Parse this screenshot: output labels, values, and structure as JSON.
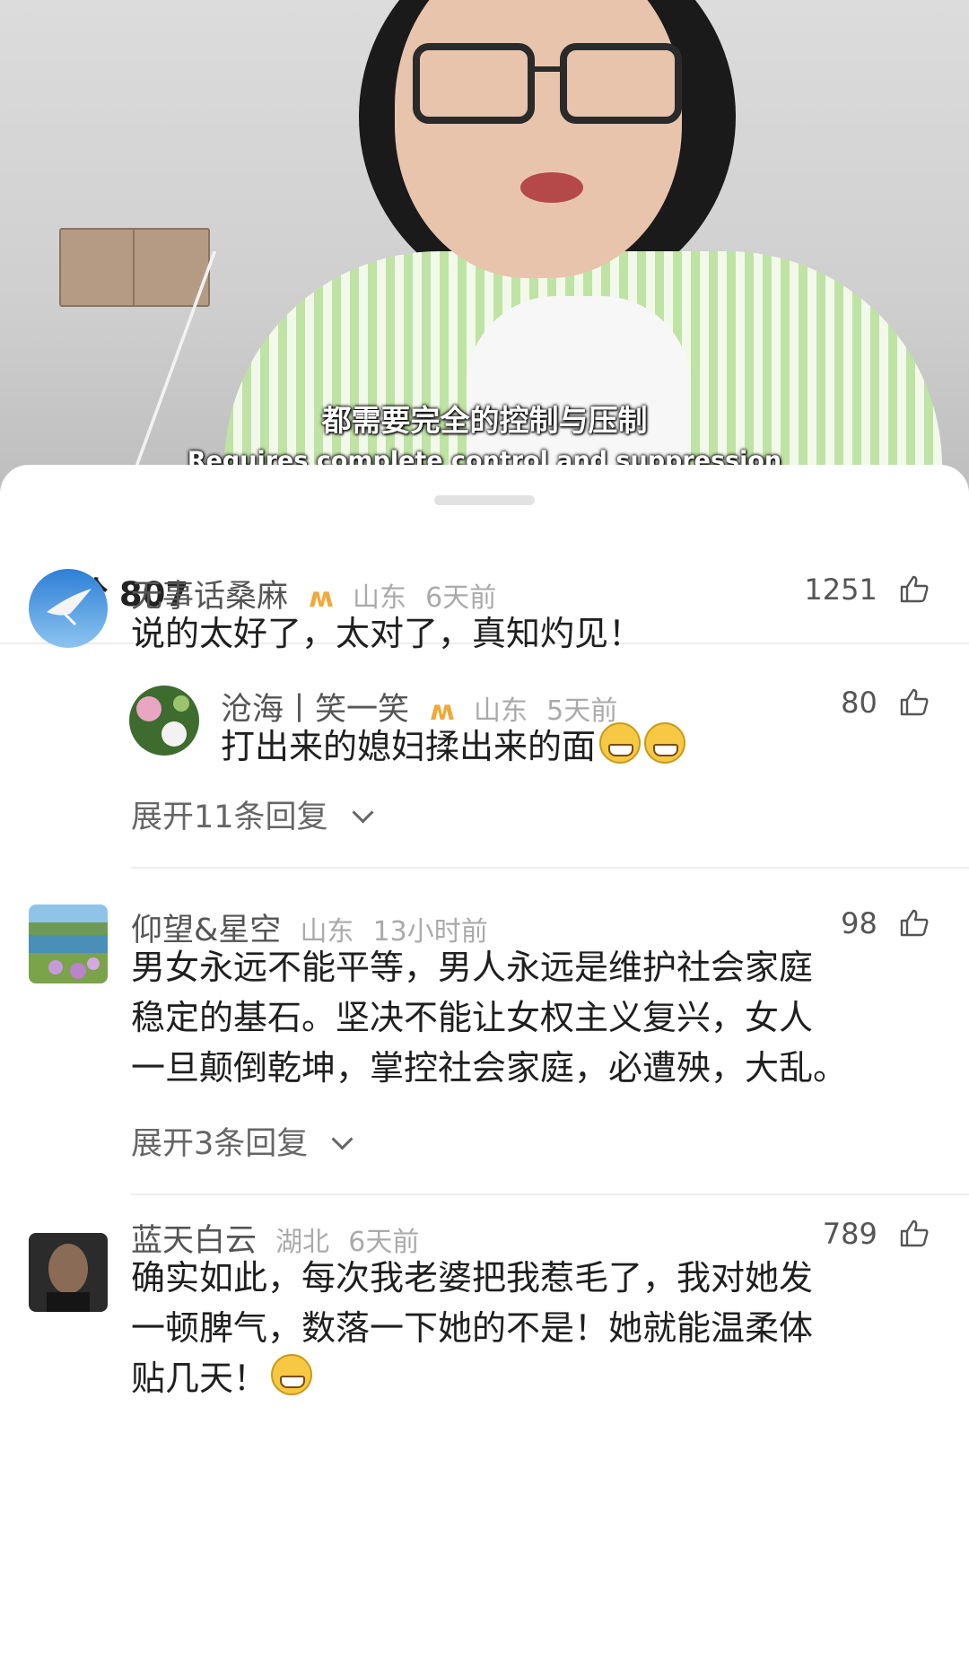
{
  "video": {
    "subtitle_cn": "都需要完全的控制与压制",
    "subtitle_en": "Requires complete control and suppression"
  },
  "comments_header": {
    "label": "评论 807"
  },
  "comments": [
    {
      "user": "无事话桑麻",
      "vip_icon": "vip-badge-icon",
      "location": "山东",
      "time": "6天前",
      "likes": "1251",
      "text": [
        "说的太好了，太对了，真知灼见！"
      ],
      "avatar_icon": "bird-avatar",
      "reply": {
        "user": "沧海丨笑一笑",
        "location": "山东",
        "time": "5天前",
        "likes": "80",
        "text": "打出来的媳妇揉出来的面",
        "emoji_icon": "grin-emoji"
      },
      "expand_label": "展开11条回复"
    },
    {
      "user": "仰望&星空",
      "location": "山东",
      "time": "13小时前",
      "likes": "98",
      "text": [
        "男女永远不能平等，男人永远是维护社会家庭",
        "稳定的基石。坚决不能让女权主义复兴，女人",
        "一旦颠倒乾坤，掌控社会家庭，必遭殃，大乱。"
      ],
      "expand_label": "展开3条回复"
    },
    {
      "user": "蓝天白云",
      "location": "湖北",
      "time": "6天前",
      "likes": "789",
      "text": [
        "确实如此，每次我老婆把我惹毛了，我对她发",
        "一顿脾气，数落一下她的不是！她就能温柔体",
        "贴几天！"
      ],
      "emoji_icon": "laugh-cry-emoji"
    }
  ],
  "colors": {
    "vip": "#f0a83a",
    "meta": "#aaaaaa",
    "divider": "#ededed"
  }
}
